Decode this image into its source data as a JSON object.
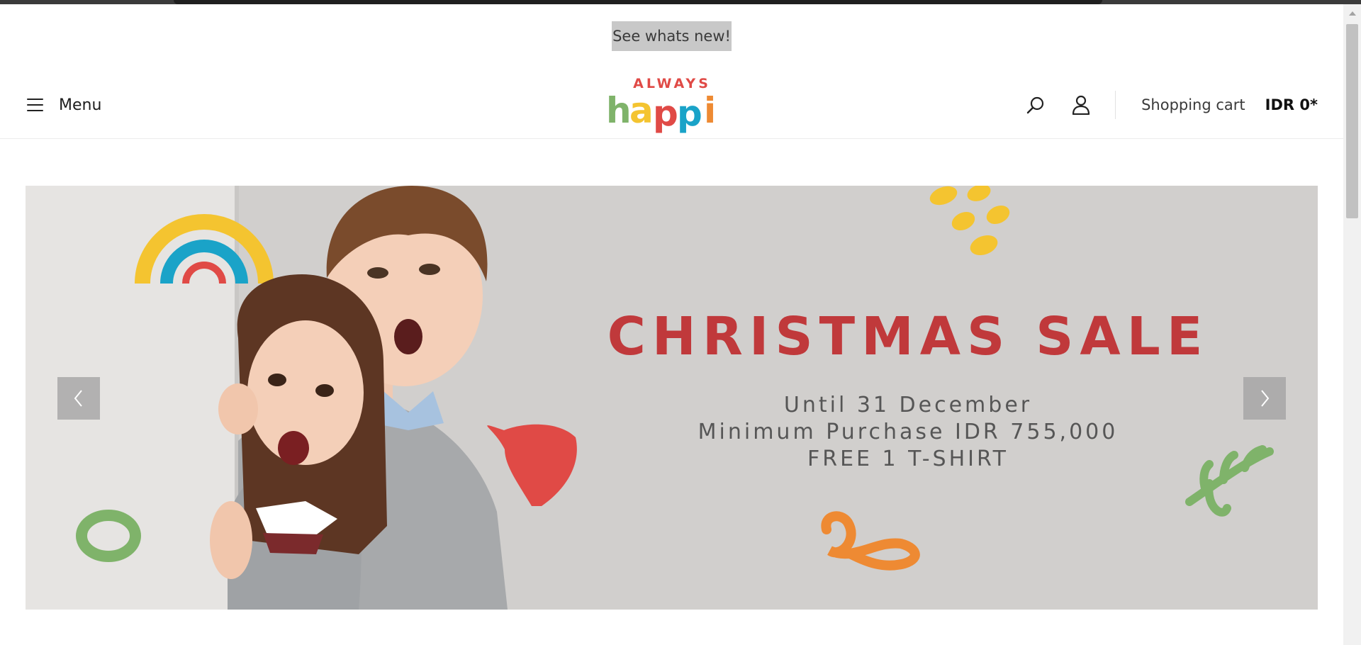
{
  "announcement": {
    "text": "See whats new!"
  },
  "header": {
    "menu_label": "Menu",
    "logo": {
      "top_text": "ALWAYS",
      "bottom_text": "happi"
    },
    "icons": [
      "search-icon",
      "account-icon",
      "menu-icon"
    ],
    "cart_label": "Shopping cart",
    "cart_total": "IDR 0*"
  },
  "banner": {
    "title": "CHRISTMAS SALE",
    "lines": [
      "Until 31 December",
      "Minimum Purchase IDR 755,000",
      "FREE 1 T-SHIRT"
    ],
    "prev_icon": "chevron-left-icon",
    "next_icon": "chevron-right-icon"
  },
  "colors": {
    "sale_red": "#c0393b",
    "banner_bg": "#d1cfcd",
    "yellow": "#f4c430",
    "blue": "#1aa3c8",
    "green": "#7fb36a",
    "orange": "#ee8a33"
  }
}
